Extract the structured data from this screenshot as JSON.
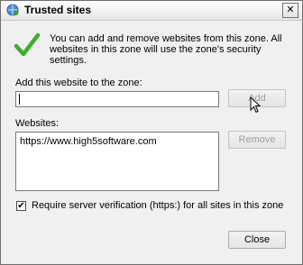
{
  "window": {
    "title": "Trusted sites",
    "close_glyph": "✕"
  },
  "info": {
    "text": "You can add and remove websites from this zone. All websites in this zone will use the zone's security settings."
  },
  "add_section": {
    "label": "Add this website to the zone:",
    "input_value": "",
    "add_button_label": "Add"
  },
  "websites_section": {
    "label": "Websites:",
    "items": [
      "https://www.high5software.com"
    ],
    "remove_button_label": "Remove"
  },
  "verification": {
    "checked": true,
    "label": "Require server verification (https:) for all sites in this zone"
  },
  "footer": {
    "close_button_label": "Close"
  },
  "colors": {
    "check_green": "#3fae2a",
    "disabled_text": "#a0a0a0"
  }
}
